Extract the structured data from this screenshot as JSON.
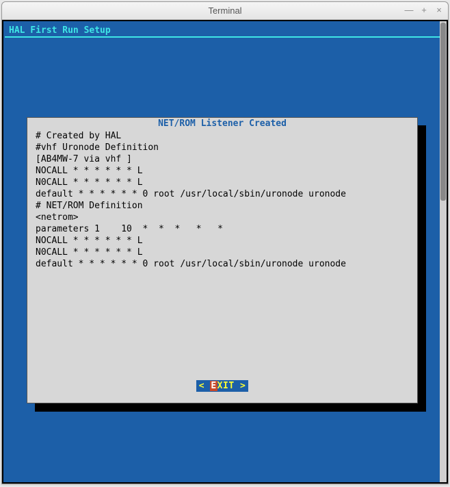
{
  "window": {
    "title": "Terminal",
    "minimize": "—",
    "maximize": "+",
    "close": "×"
  },
  "app": {
    "title": "HAL First Run Setup"
  },
  "dialog": {
    "title": "NET/ROM Listener Created",
    "lines": [
      "# Created by HAL",
      "#vhf Uronode Definition",
      "[AB4MW-7 via vhf ]",
      "NOCALL * * * * * * L",
      "N0CALL * * * * * * L",
      "default * * * * * * 0 root /usr/local/sbin/uronode uronode",
      "# NET/ROM Definition",
      "<netrom>",
      "parameters 1    10  *  *  *   *   *",
      "NOCALL * * * * * * L",
      "N0CALL * * * * * * L",
      "default * * * * * * 0 root /usr/local/sbin/uronode uronode"
    ],
    "button": {
      "left_bracket": "< ",
      "hotkey": "E",
      "rest": "XIT ",
      "right_bracket": ">"
    }
  }
}
